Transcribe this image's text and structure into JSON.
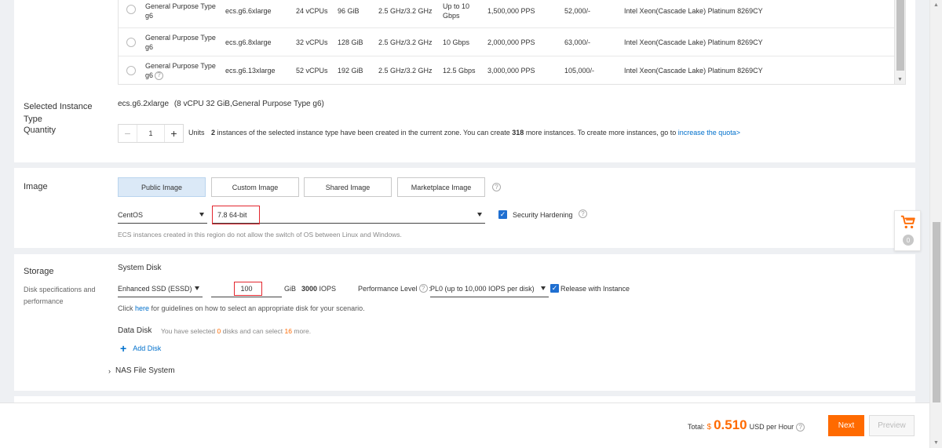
{
  "instance_table": {
    "rows": [
      {
        "family": "General Purpose Type g6",
        "family_line1": "General Purpose Type",
        "family_line2": "g6",
        "type": "ecs.g6.6xlarge",
        "vcpus": "24 vCPUs",
        "memory": "96 GiB",
        "clock": "2.5 GHz/3.2 GHz",
        "bandwidth_line1": "Up to 10",
        "bandwidth_line2": "Gbps",
        "pps": "1,500,000 PPS",
        "ipv6": "52,000/-",
        "processor": "Intel Xeon(Cascade Lake) Platinum 8269CY"
      },
      {
        "family_line1": "General Purpose Type",
        "family_line2": "g6",
        "type": "ecs.g6.8xlarge",
        "vcpus": "32 vCPUs",
        "memory": "128 GiB",
        "clock": "2.5 GHz/3.2 GHz",
        "bandwidth_line1": "10 Gbps",
        "bandwidth_line2": "",
        "pps": "2,000,000 PPS",
        "ipv6": "63,000/-",
        "processor": "Intel Xeon(Cascade Lake) Platinum 8269CY"
      },
      {
        "family_line1": "General Purpose Type",
        "family_line2": "g6",
        "type": "ecs.g6.13xlarge",
        "vcpus": "52 vCPUs",
        "memory": "192 GiB",
        "clock": "2.5 GHz/3.2 GHz",
        "bandwidth_line1": "12.5 Gbps",
        "bandwidth_line2": "",
        "pps": "3,000,000 PPS",
        "ipv6": "105,000/-",
        "processor": "Intel Xeon(Cascade Lake) Platinum 8269CY"
      }
    ]
  },
  "selected_instance": {
    "label": "Selected Instance Type",
    "value": "ecs.g6.2xlarge",
    "detail": "(8 vCPU 32 GiB,General Purpose Type g6)"
  },
  "quantity": {
    "label": "Quantity",
    "minus": "−",
    "value": "1",
    "plus": "+",
    "units": "Units",
    "created_count": "2",
    "text_before_created": " instances of the selected instance type have been created in the current zone. You can create ",
    "more_count": "318",
    "text_after_more": " more instances. To create more instances, go to ",
    "quota_link": "increase the quota>"
  },
  "image": {
    "label": "Image",
    "tabs": [
      "Public Image",
      "Custom Image",
      "Shared Image",
      "Marketplace Image"
    ],
    "help": "?",
    "os": "CentOS",
    "version": "7.8 64-bit",
    "security_hardening": "Security Hardening",
    "security_hardening_checked": true,
    "note": "ECS instances created in this region do not allow the switch of OS between Linux and Windows."
  },
  "storage": {
    "label": "Storage",
    "sublabel_line1": "Disk specifications and",
    "sublabel_line2": "performance",
    "system_disk_title": "System Disk",
    "disk_type": "Enhanced SSD (ESSD)",
    "size": "100",
    "size_unit": "GiB",
    "iops_value": "3000",
    "iops_unit": "IOPS",
    "perf_label": "Performance Level",
    "perf_colon": ":",
    "perf_value": "PL0 (up to 10,000 IOPS per disk)",
    "release_label": "Release with Instance",
    "release_checked": true,
    "guide_prefix": "Click ",
    "guide_link": "here",
    "guide_suffix": " for guidelines on how to select an appropriate disk for your scenario.",
    "data_disk_title": "Data Disk",
    "data_disk_prefix": "You have selected ",
    "data_disk_selected": "0",
    "data_disk_middle": " disks and can select ",
    "data_disk_remaining": "16",
    "data_disk_suffix": " more.",
    "add_disk": "Add Disk",
    "nas": "NAS File System"
  },
  "cart": {
    "count": "0"
  },
  "footer": {
    "total_label": "Total:",
    "currency": "$",
    "amount": "0.510",
    "unit": "USD per Hour",
    "next": "Next",
    "previous": "Preview"
  },
  "colors": {
    "accent": "#ff6a00",
    "link": "#0070cc",
    "checkbox": "#1f6fd1",
    "highlight_box": "#e3262e"
  }
}
